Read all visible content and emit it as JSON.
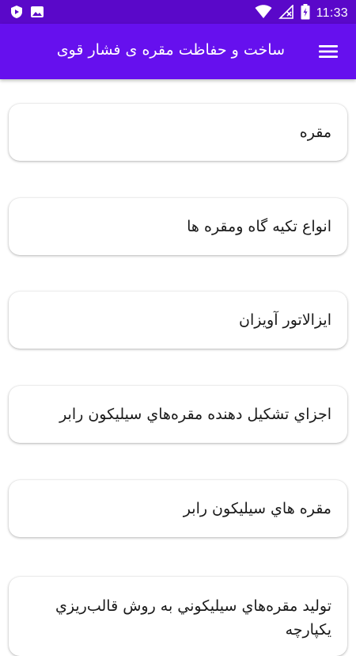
{
  "status_bar": {
    "time": "11:33",
    "left_icons": [
      "shield-play-icon",
      "image-icon"
    ],
    "right_icons": [
      "wifi-icon",
      "no-signal-icon",
      "battery-charging-icon"
    ]
  },
  "app_bar": {
    "title": "ساخت و حفاظت مقره ی فشار قوی",
    "menu_icon": "hamburger-menu-icon",
    "color": "#6610ee",
    "status_color": "#5a08c9"
  },
  "items": [
    {
      "label": "مقره"
    },
    {
      "label": "انواع تکیه گاه ومقره ها"
    },
    {
      "label": "ایزالاتور آویزان"
    },
    {
      "label": "اجزاي تشكيل دهنده مقره‌هاي سيليكون رابر"
    },
    {
      "label": "مقره هاي سيليكون رابر"
    },
    {
      "label": "توليد مقره‌هاي سيليكوني به روش قالب‌ريزي يكپارچه"
    }
  ]
}
